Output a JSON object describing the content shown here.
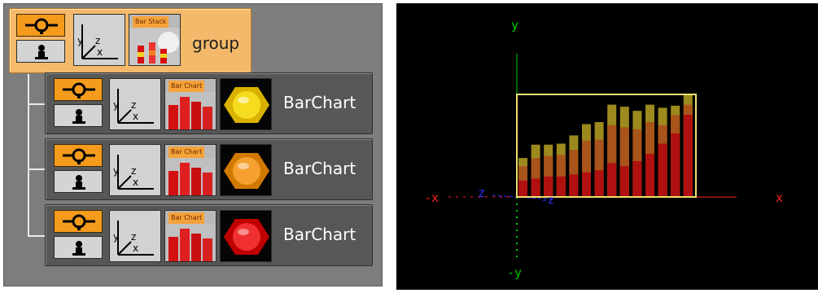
{
  "tree": {
    "group": {
      "label": "group",
      "plugin_title": "Bar Stack",
      "axis": {
        "y": "y",
        "z": "z",
        "x": "x"
      }
    },
    "children": [
      {
        "label": "BarChart",
        "plugin_title": "Bar Chart",
        "material_color": "#f5dc1e",
        "material_dark": "#b58f00",
        "hex_color": "#d9b200"
      },
      {
        "label": "BarChart",
        "plugin_title": "Bar Chart",
        "material_color": "#f5a030",
        "material_dark": "#a25a00",
        "hex_color": "#d27a00"
      },
      {
        "label": "BarChart",
        "plugin_title": "Bar Chart",
        "material_color": "#f03030",
        "material_dark": "#8a0000",
        "hex_color": "#c00000"
      }
    ],
    "axis_labels": {
      "y": "y",
      "z": "z",
      "x": "x"
    }
  },
  "viewport": {
    "labels": {
      "y_pos": "y",
      "y_neg": "-y",
      "x_pos": "x",
      "x_neg": "-x",
      "z_pos": "z",
      "z_neg": "-z"
    },
    "colors": {
      "y_axis": "#00cc00",
      "x_axis": "#ff2020",
      "z_axis": "#3030ff",
      "bbox": "#f0e070",
      "bar_top": "#9c8a1e",
      "bar_mid": "#a8541a",
      "bar_low": "#b01010"
    },
    "bars": [
      {
        "total": 0.38,
        "mid": 0.3,
        "low": 0.16
      },
      {
        "total": 0.51,
        "mid": 0.38,
        "low": 0.18
      },
      {
        "total": 0.51,
        "mid": 0.4,
        "low": 0.2
      },
      {
        "total": 0.52,
        "mid": 0.41,
        "low": 0.2
      },
      {
        "total": 0.6,
        "mid": 0.46,
        "low": 0.22
      },
      {
        "total": 0.71,
        "mid": 0.55,
        "low": 0.24
      },
      {
        "total": 0.73,
        "mid": 0.56,
        "low": 0.26
      },
      {
        "total": 0.9,
        "mid": 0.7,
        "low": 0.33
      },
      {
        "total": 0.88,
        "mid": 0.68,
        "low": 0.3
      },
      {
        "total": 0.84,
        "mid": 0.66,
        "low": 0.35
      },
      {
        "total": 0.9,
        "mid": 0.73,
        "low": 0.42
      },
      {
        "total": 0.87,
        "mid": 0.7,
        "low": 0.52
      },
      {
        "total": 0.89,
        "mid": 0.8,
        "low": 0.62
      },
      {
        "total": 1.0,
        "mid": 0.9,
        "low": 0.8
      }
    ]
  }
}
